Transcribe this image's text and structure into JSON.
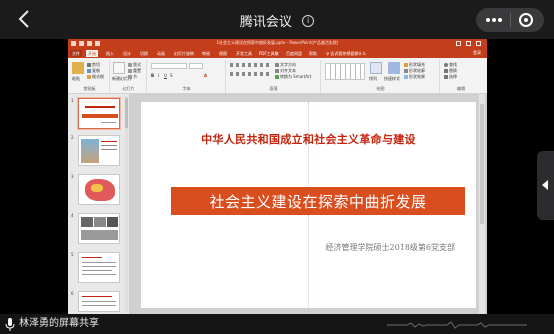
{
  "topbar": {
    "title": "腾讯会议",
    "back_icon": "chevron-left-icon",
    "info_icon": "info-icon",
    "more_icon": "more-dots-icon",
    "exit_icon": "target-close-icon"
  },
  "ppt": {
    "doc_title": "1社会主义建设在探索中曲折发展.pptx - PowerPoint(产品激活失败)",
    "tabs": [
      "文件",
      "开始",
      "插入",
      "设计",
      "切换",
      "动画",
      "幻灯片放映",
      "审阅",
      "视图",
      "开发工具",
      "PDF工具集",
      "百度网盘",
      "帮助",
      "♀ 告诉我你想要做什么"
    ],
    "active_tab": "开始",
    "login": "登录",
    "ribbon": {
      "clipboard": {
        "label": "剪贴板",
        "paste": "粘贴",
        "cut": "剪切",
        "copy": "复制",
        "format_painter": "格式刷"
      },
      "slides": {
        "label": "幻灯片",
        "new_slide": "新建幻灯片",
        "layout": "版式",
        "reset": "重置",
        "section": "节"
      },
      "font": {
        "label": "字体"
      },
      "paragraph": {
        "label": "段落",
        "text_direction": "文字方向",
        "align_text": "对齐文本",
        "smartart": "转换为 SmartArt"
      },
      "drawing": {
        "label": "绘图",
        "arrange": "排列",
        "quick_styles": "快速样式",
        "shape_fill": "形状填充",
        "shape_outline": "形状轮廓",
        "shape_effects": "形状效果"
      },
      "editing": {
        "label": "编辑",
        "find": "查找",
        "replace": "替换",
        "select": "选择"
      }
    },
    "thumbnails": [
      "1",
      "2",
      "3",
      "4",
      "5",
      "6"
    ],
    "slide": {
      "heading": "中华人民共和国成立和社会主义革命与建设",
      "band_text": "社会主义建设在探索中曲折发展",
      "subtitle": "经济管理学院硕士2018级第6党支部",
      "accent_color": "#d94e1f",
      "heading_color": "#c4240e"
    }
  },
  "bottom": {
    "share_label": "林泽勇的屏幕共享",
    "mic_icon": "microphone-icon"
  }
}
